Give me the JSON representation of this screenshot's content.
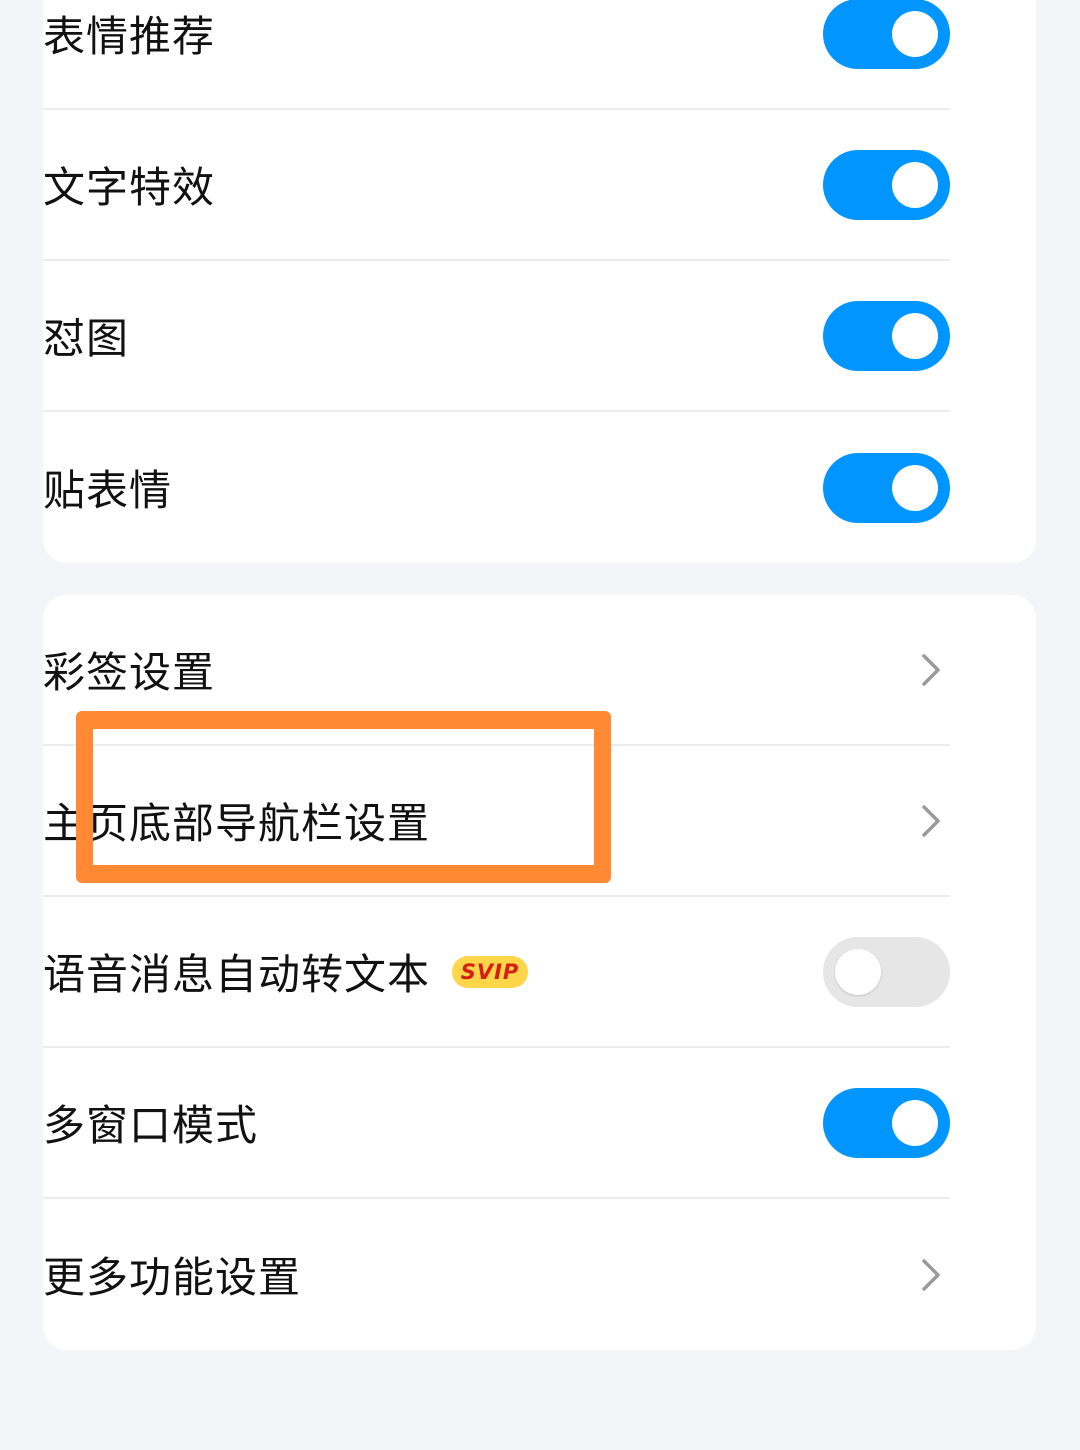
{
  "sections": [
    {
      "items": [
        {
          "label": "表情推荐",
          "control": "toggle",
          "on": true
        },
        {
          "label": "文字特效",
          "control": "toggle",
          "on": true
        },
        {
          "label": "怼图",
          "control": "toggle",
          "on": true
        },
        {
          "label": "贴表情",
          "control": "toggle",
          "on": true
        }
      ]
    },
    {
      "items": [
        {
          "label": "彩签设置",
          "control": "chevron",
          "icon": "chevron-right-icon"
        },
        {
          "label": "主页底部导航栏设置",
          "control": "chevron",
          "icon": "chevron-right-icon",
          "highlighted": true
        },
        {
          "label": "语音消息自动转文本",
          "badge": "SVIP",
          "control": "toggle",
          "on": false
        },
        {
          "label": "多窗口模式",
          "control": "toggle",
          "on": true
        },
        {
          "label": "更多功能设置",
          "control": "chevron",
          "icon": "chevron-right-icon"
        }
      ]
    }
  ],
  "colors": {
    "background": "#f4f5f9",
    "card": "#ffffff",
    "toggle_on": "#0095ff",
    "toggle_off": "#e6e6e6",
    "highlight_box": "#ff8a33",
    "badge_bg": "#ffd54a",
    "badge_text": "#d41e16"
  }
}
